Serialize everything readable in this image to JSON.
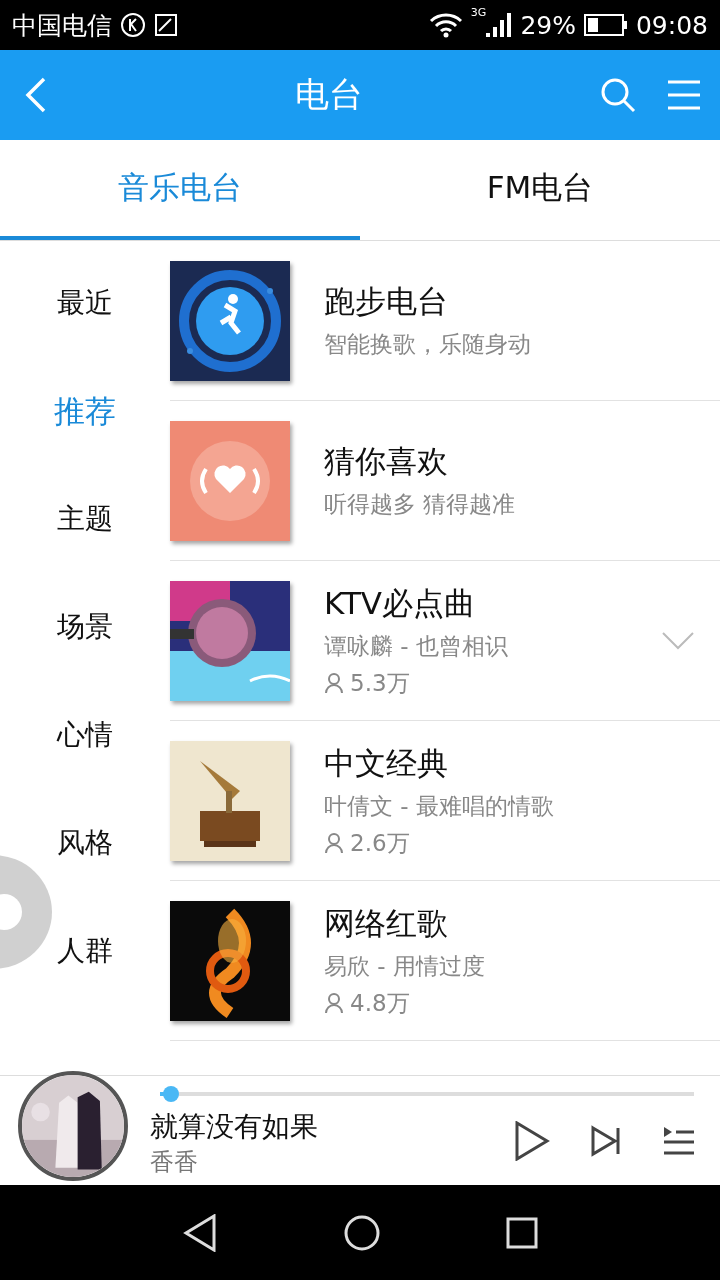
{
  "status_bar": {
    "carrier": "中国电信",
    "network": "3G",
    "battery": "29%",
    "time": "09:08"
  },
  "header": {
    "title": "电台"
  },
  "tabs": [
    {
      "label": "音乐电台",
      "selected": true
    },
    {
      "label": "FM电台",
      "selected": false
    }
  ],
  "sidebar": {
    "items": [
      {
        "label": "最近",
        "selected": false
      },
      {
        "label": "推荐",
        "selected": true
      },
      {
        "label": "主题",
        "selected": false
      },
      {
        "label": "场景",
        "selected": false
      },
      {
        "label": "心情",
        "selected": false
      },
      {
        "label": "风格",
        "selected": false
      },
      {
        "label": "人群",
        "selected": false
      }
    ]
  },
  "stations": [
    {
      "kind": "feature",
      "title": "跑步电台",
      "subtitle": "智能换歌，乐随身动",
      "more": false
    },
    {
      "kind": "feature",
      "title": "猜你喜欢",
      "subtitle": "听得越多 猜得越准",
      "more": false
    },
    {
      "kind": "playlist",
      "title": "KTV必点曲",
      "subtitle": "谭咏麟 - 也曾相识",
      "listeners": "5.3万",
      "more": true
    },
    {
      "kind": "playlist",
      "title": "中文经典",
      "subtitle": "叶倩文 - 最难唱的情歌",
      "listeners": "2.6万",
      "more": false
    },
    {
      "kind": "playlist",
      "title": "网络红歌",
      "subtitle": "易欣 - 用情过度",
      "listeners": "4.8万",
      "more": false
    }
  ],
  "player": {
    "title": "就算没有如果",
    "artist": "香香",
    "level": 0.02
  }
}
